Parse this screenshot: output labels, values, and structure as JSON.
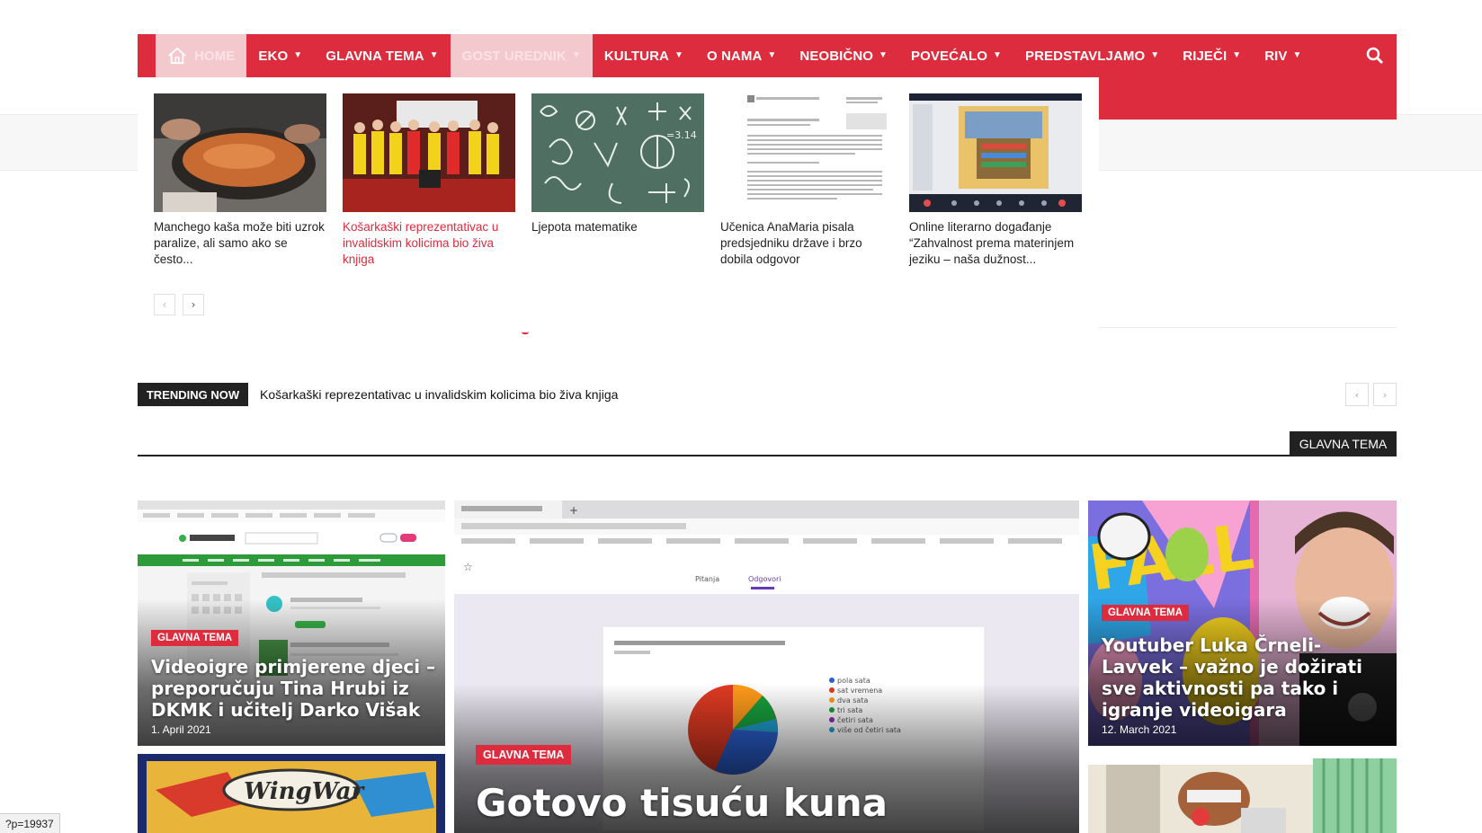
{
  "nav": {
    "items": [
      {
        "label": "HOME",
        "active": false,
        "dropdown": false
      },
      {
        "label": "EKO",
        "dropdown": true
      },
      {
        "label": "GLAVNA TEMA",
        "dropdown": true
      },
      {
        "label": "GOST UREDNIK",
        "dropdown": true,
        "active": true
      },
      {
        "label": "KULTURA",
        "dropdown": true
      },
      {
        "label": "O NAMA",
        "dropdown": true
      },
      {
        "label": "NEOBIČNO",
        "dropdown": true
      },
      {
        "label": "POVEĆALO",
        "dropdown": true
      },
      {
        "label": "PREDSTAVLJAMO",
        "dropdown": true
      },
      {
        "label": "RIJEČI",
        "dropdown": true
      },
      {
        "label": "RIV",
        "dropdown": true
      }
    ],
    "search_icon": "search-icon",
    "home_icon": "home-icon",
    "chevron_icon": "chevron-down-icon"
  },
  "mega_menu": {
    "articles": [
      {
        "title": "Manchego kaša može biti uzrok paralize, ali samo ako se često...",
        "highlight": false
      },
      {
        "title": "Košarkaški reprezentativac u invalidskim kolicima bio živa knjiga",
        "highlight": true
      },
      {
        "title": "Ljepota matematike",
        "highlight": false
      },
      {
        "title": "Učenica AnaMaria pisala predsjedniku države i brzo dobila odgovor",
        "highlight": false
      },
      {
        "title": "Online literarno događanje “Zahvalnost prema materinjem jeziku – naša dužnost...",
        "highlight": false
      }
    ],
    "prev": "‹",
    "next": "›"
  },
  "trending": {
    "label": "TRENDING NOW",
    "headline": "Košarkaški reprezentativac u invalidskim kolicima bio živa knjiga",
    "prev": "‹",
    "next": "›"
  },
  "section": {
    "label": "GLAVNA TEMA"
  },
  "tiles": [
    {
      "category": "GLAVNA TEMA",
      "title": "Videoigre primjerene djeci – preporučuju Tina Hrubi iz DKMK i učitelj Darko Višak",
      "date": "1. April 2021"
    },
    {
      "category": "GLAVNA TEMA",
      "title": "Gotovo tisuću kuna",
      "date": ""
    },
    {
      "category": "GLAVNA TEMA",
      "title": "Youtuber Luka Črneli-Lavvek – važno je dožirati sve aktivnosti pa tako i igranje videoigara",
      "date": "12. March 2021"
    }
  ],
  "status_bar": {
    "url": "?p=19937"
  },
  "colors": {
    "brand": "#dc2c3e",
    "dark": "#222222"
  }
}
